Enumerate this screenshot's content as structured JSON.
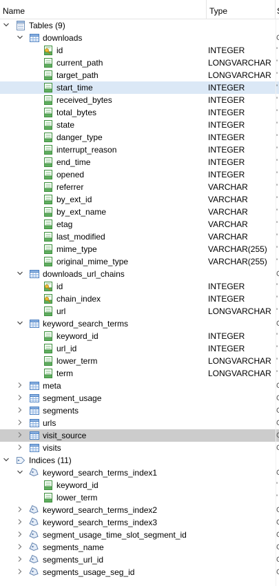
{
  "columns": {
    "name": "Name",
    "type": "Type",
    "third": "S"
  },
  "tables_group": "Tables (9)",
  "downloads": {
    "label": "downloads",
    "columns": [
      {
        "name": "id",
        "type": "INTEGER",
        "key": true
      },
      {
        "name": "current_path",
        "type": "LONGVARCHAR"
      },
      {
        "name": "target_path",
        "type": "LONGVARCHAR"
      },
      {
        "name": "start_time",
        "type": "INTEGER"
      },
      {
        "name": "received_bytes",
        "type": "INTEGER"
      },
      {
        "name": "total_bytes",
        "type": "INTEGER"
      },
      {
        "name": "state",
        "type": "INTEGER"
      },
      {
        "name": "danger_type",
        "type": "INTEGER"
      },
      {
        "name": "interrupt_reason",
        "type": "INTEGER"
      },
      {
        "name": "end_time",
        "type": "INTEGER"
      },
      {
        "name": "opened",
        "type": "INTEGER"
      },
      {
        "name": "referrer",
        "type": "VARCHAR"
      },
      {
        "name": "by_ext_id",
        "type": "VARCHAR"
      },
      {
        "name": "by_ext_name",
        "type": "VARCHAR"
      },
      {
        "name": "etag",
        "type": "VARCHAR"
      },
      {
        "name": "last_modified",
        "type": "VARCHAR"
      },
      {
        "name": "mime_type",
        "type": "VARCHAR(255)"
      },
      {
        "name": "original_mime_type",
        "type": "VARCHAR(255)"
      }
    ]
  },
  "downloads_url_chains": {
    "label": "downloads_url_chains",
    "columns": [
      {
        "name": "id",
        "type": "INTEGER",
        "key": true
      },
      {
        "name": "chain_index",
        "type": "INTEGER",
        "key": true
      },
      {
        "name": "url",
        "type": "LONGVARCHAR"
      }
    ]
  },
  "keyword_search_terms": {
    "label": "keyword_search_terms",
    "columns": [
      {
        "name": "keyword_id",
        "type": "INTEGER"
      },
      {
        "name": "url_id",
        "type": "INTEGER"
      },
      {
        "name": "lower_term",
        "type": "LONGVARCHAR"
      },
      {
        "name": "term",
        "type": "LONGVARCHAR"
      }
    ]
  },
  "collapsed_tables": [
    "meta",
    "segment_usage",
    "segments",
    "urls",
    "visit_source",
    "visits"
  ],
  "indices_group": "Indices (11)",
  "index1": {
    "label": "keyword_search_terms_index1",
    "columns": [
      "keyword_id",
      "lower_term"
    ]
  },
  "collapsed_indices": [
    "keyword_search_terms_index2",
    "keyword_search_terms_index3",
    "segment_usage_time_slot_segment_id",
    "segments_name",
    "segments_url_id",
    "segments_usage_seg_id"
  ],
  "colors": {
    "hover_row": "#dbe8f6",
    "selected_row": "#cccccc",
    "table_icon": "#4a7fc1",
    "column_icon": "#3f8f3f",
    "key": "#e0a800"
  }
}
